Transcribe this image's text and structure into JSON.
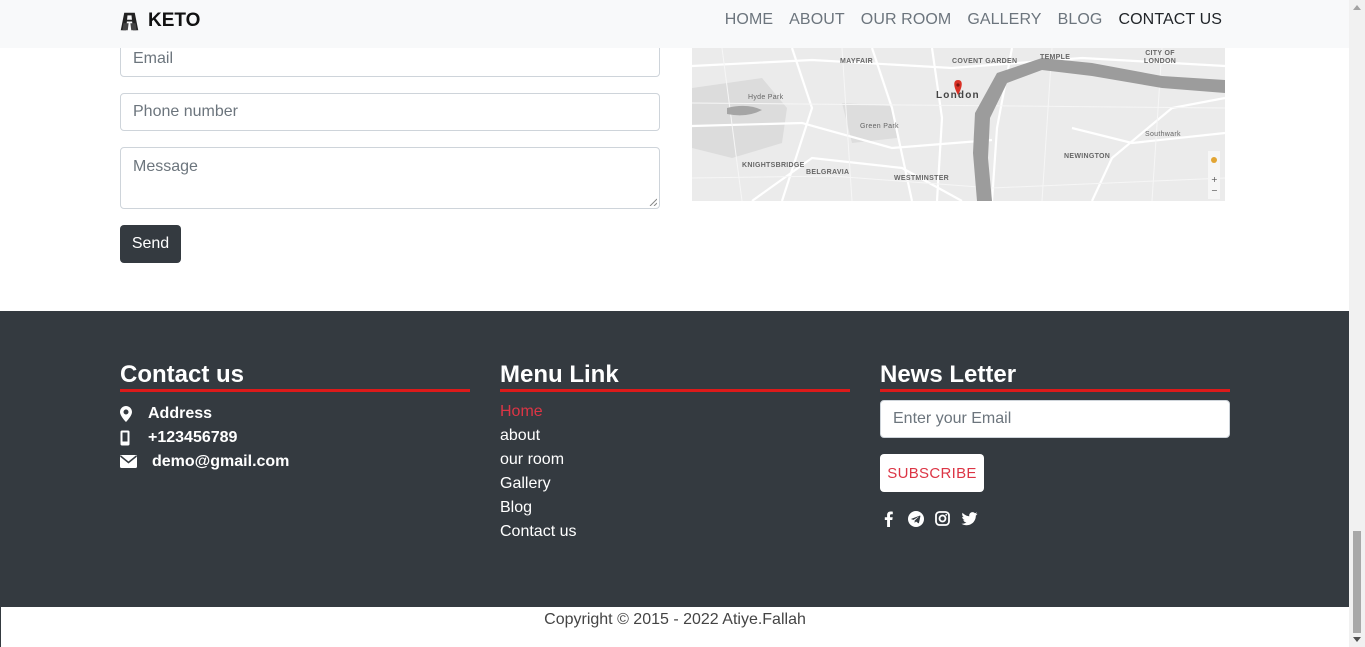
{
  "navbar": {
    "brand": "KETO",
    "links": [
      "HOME",
      "ABOUT",
      "OUR ROOM",
      "GALLERY",
      "BLOG",
      "CONTACT US"
    ],
    "active": "CONTACT US"
  },
  "form": {
    "email_placeholder": "Email",
    "phone_placeholder": "Phone number",
    "message_placeholder": "Message",
    "send_label": "Send"
  },
  "map": {
    "city": "London",
    "labels": [
      "MAYFAIR",
      "COVENT GARDEN",
      "TEMPLE",
      "CITY OF LONDON",
      "KNIGHTSBRIDGE",
      "BELGRAVIA",
      "WESTMINSTER",
      "NEWINGTON",
      "Southwark",
      "Hyde Park",
      "Green Park"
    ]
  },
  "footer": {
    "contact": {
      "title": "Contact us",
      "address": "Address",
      "phone": "+123456789",
      "email": "demo@gmail.com"
    },
    "menu": {
      "title": "Menu Link",
      "items": [
        "Home",
        "about",
        "our room",
        "Gallery",
        "Blog",
        "Contact us"
      ]
    },
    "newsletter": {
      "title": "News Letter",
      "placeholder": "Enter your Email",
      "subscribe_label": "SUBSCRIBE",
      "socials": [
        "facebook-icon",
        "telegram-icon",
        "instagram-icon",
        "twitter-icon"
      ]
    }
  },
  "copyright": "Copyright © 2015 - 2022 Atiye.Fallah",
  "colors": {
    "accent": "#dc1a1a",
    "footer_bg": "#343a40",
    "active_link": "#dc3545"
  }
}
